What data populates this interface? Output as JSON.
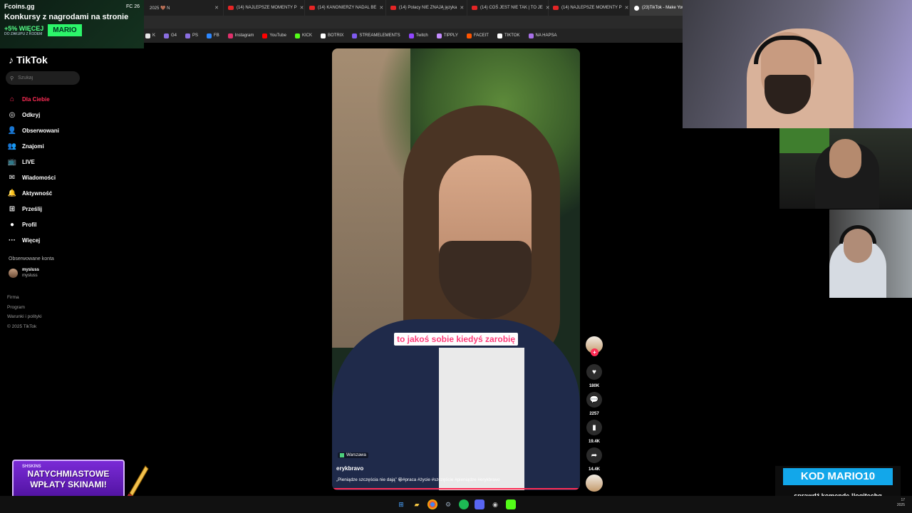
{
  "browser": {
    "tabs": [
      {
        "label": "2025 🤎 N",
        "kind": "other"
      },
      {
        "label": "(14) NAJLEPSZE MOMENTY P",
        "kind": "yt"
      },
      {
        "label": "(14) KANONIERZY NADAL BE",
        "kind": "yt"
      },
      {
        "label": "(14) Polacy NIE ZNAJĄ języka",
        "kind": "yt"
      },
      {
        "label": "(14) COŚ JEST NIE TAK | TO JE",
        "kind": "yt"
      },
      {
        "label": "(14) NAJLEPSZE MOMENTY P",
        "kind": "yt"
      },
      {
        "label": "(23)TikTok - Make Your Day",
        "kind": "tt"
      },
      {
        "label": "V",
        "kind": "other"
      }
    ],
    "bookmarks": [
      {
        "label": "K",
        "color": "#e6e6e6"
      },
      {
        "label": "G4",
        "color": "#8a6ee0"
      },
      {
        "label": "PS",
        "color": "#8a6ee0"
      },
      {
        "label": "FB",
        "color": "#2d88ff"
      },
      {
        "label": "Instagram",
        "color": "#e1306c"
      },
      {
        "label": "YouTube",
        "color": "#ff0000"
      },
      {
        "label": "KICK",
        "color": "#53fc18"
      },
      {
        "label": "BOTRIX",
        "color": "#ffffff"
      },
      {
        "label": "STREAMELEMENTS",
        "color": "#7f5af0"
      },
      {
        "label": "Twitch",
        "color": "#9146ff"
      },
      {
        "label": "TIPPLY",
        "color": "#c48cff"
      },
      {
        "label": "FACEIT",
        "color": "#ff5500"
      },
      {
        "label": "TIKTOK",
        "color": "#ffffff"
      },
      {
        "label": "NA HAPSA",
        "color": "#a870e8"
      }
    ]
  },
  "promo": {
    "logo": "Fcoins.gg",
    "status": "FC 26",
    "title": "Konkursy z nagrodami na stronie",
    "bonus": "+5% WIĘCEJ",
    "bonus_sub": "DO ZAKUPU Z KODEM",
    "code": "MARIO"
  },
  "tiktok": {
    "logo": "TikTok",
    "search_placeholder": "Szukaj",
    "nav": [
      {
        "label": "Dla Ciebie",
        "icon": "home-icon",
        "glyph": "⌂",
        "active": true
      },
      {
        "label": "Odkryj",
        "icon": "compass-icon",
        "glyph": "◎",
        "active": false
      },
      {
        "label": "Obserwowani",
        "icon": "following-icon",
        "glyph": "👤",
        "active": false
      },
      {
        "label": "Znajomi",
        "icon": "friends-icon",
        "glyph": "👥",
        "active": false
      },
      {
        "label": "LIVE",
        "icon": "live-icon",
        "glyph": "📺",
        "active": false
      },
      {
        "label": "Wiadomości",
        "icon": "messages-icon",
        "glyph": "✉",
        "active": false
      },
      {
        "label": "Aktywność",
        "icon": "activity-icon",
        "glyph": "🔔",
        "active": false
      },
      {
        "label": "Prześlij",
        "icon": "upload-icon",
        "glyph": "⊞",
        "active": false
      },
      {
        "label": "Profil",
        "icon": "profile-icon",
        "glyph": "●",
        "active": false
      },
      {
        "label": "Więcej",
        "icon": "more-icon",
        "glyph": "···",
        "active": false
      }
    ],
    "followed_title": "Obserwowane konta",
    "followed": [
      {
        "name": "mysluss",
        "handle": "mysluss"
      }
    ],
    "footer": [
      "Firma",
      "Program",
      "Warunki i polityki",
      "© 2025 TikTok"
    ]
  },
  "video": {
    "subtitle": "to jakoś sobie kiedyś zarobię",
    "location": "Warszawa",
    "author": "erykbravo",
    "description": "„Pieniądze szczęścia nie dają” 😀#praca #życie #szczęście #pieniądze #erykbravo",
    "likes": "180K",
    "comments": "2257",
    "saves": "19.4K",
    "shares": "14.4K"
  },
  "overlay": {
    "skins_brand": "SHSKINS",
    "skins_line1": "NATYCHMIASTOWE",
    "skins_line2": "WPŁATY SKINAMI!",
    "code_title": "KOD MARIO10",
    "code_hint": "sprawdź komendę !logitechg"
  },
  "taskbar": {
    "time": "17",
    "date": "2025"
  }
}
